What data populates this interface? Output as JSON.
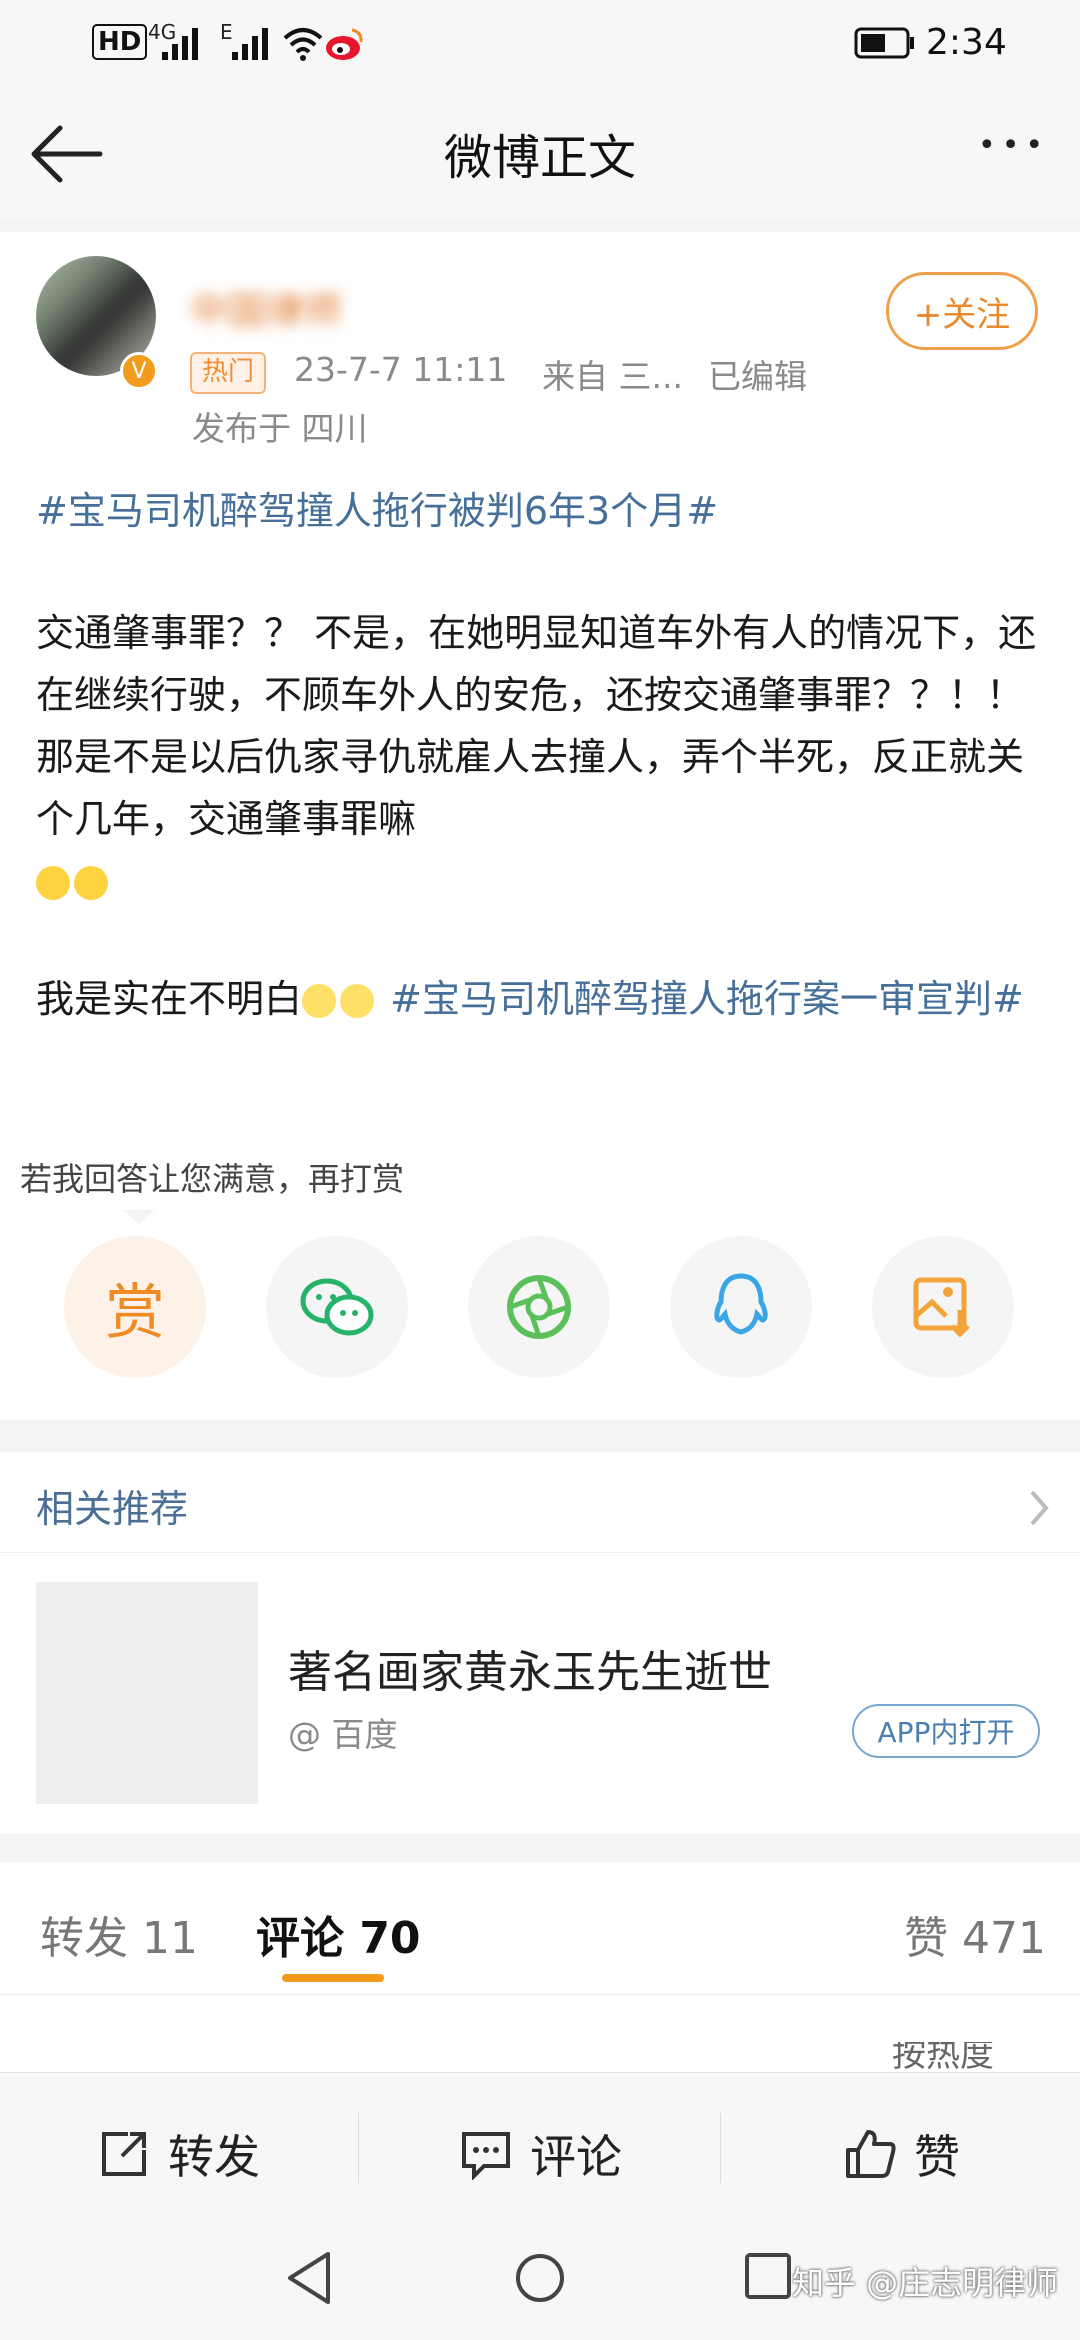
{
  "status_bar": {
    "hd": "HD",
    "sim1": "4G",
    "sim2": "E",
    "time": "2:34"
  },
  "title_bar": {
    "title": "微博正文",
    "more": "•••"
  },
  "post": {
    "username": "中国律师",
    "hot_badge": "热门",
    "date": "23-7-7 11:11",
    "source": "来自 三...",
    "edited": "已编辑",
    "location": "发布于 四川",
    "follow_label": "+关注",
    "topic1": "#宝马司机醉驾撞人拖行被判6年3个月#",
    "paragraph1": "交通肇事罪？？ 不是，在她明显知道车外有人的情况下，还在继续行驶，不顾车外人的安危，还按交通肇事罪？？！！ 那是不是以后仇家寻仇就雇人去撞人，弄个半死，反正就关个几年，交通肇事罪嘛",
    "paragraph2_text": "我是实在不明白",
    "topic2": "#宝马司机醉驾撞人拖行案一审宣判#"
  },
  "reward": {
    "prompt": "若我回答让您满意，再打赏",
    "reward_label": "赏",
    "share_targets": [
      "wechat-icon",
      "moments-icon",
      "qq-icon",
      "save-image-icon"
    ]
  },
  "related": {
    "header": "相关推荐",
    "item_title": "著名画家黄永玉先生逝世",
    "item_source": "@ 百度",
    "app_open": "APP内打开"
  },
  "tabs": {
    "repost": "转发 11",
    "comment": "评论 70",
    "like": "赞 471",
    "sort_partial": "按热度"
  },
  "actions": {
    "repost": "转发",
    "comment": "评论",
    "like": "赞"
  },
  "watermark": "知乎 @庄志明律师",
  "colors": {
    "accent_orange": "#f0a04b",
    "topic_blue": "#46709a",
    "tab_indicator": "#f39a1d"
  }
}
